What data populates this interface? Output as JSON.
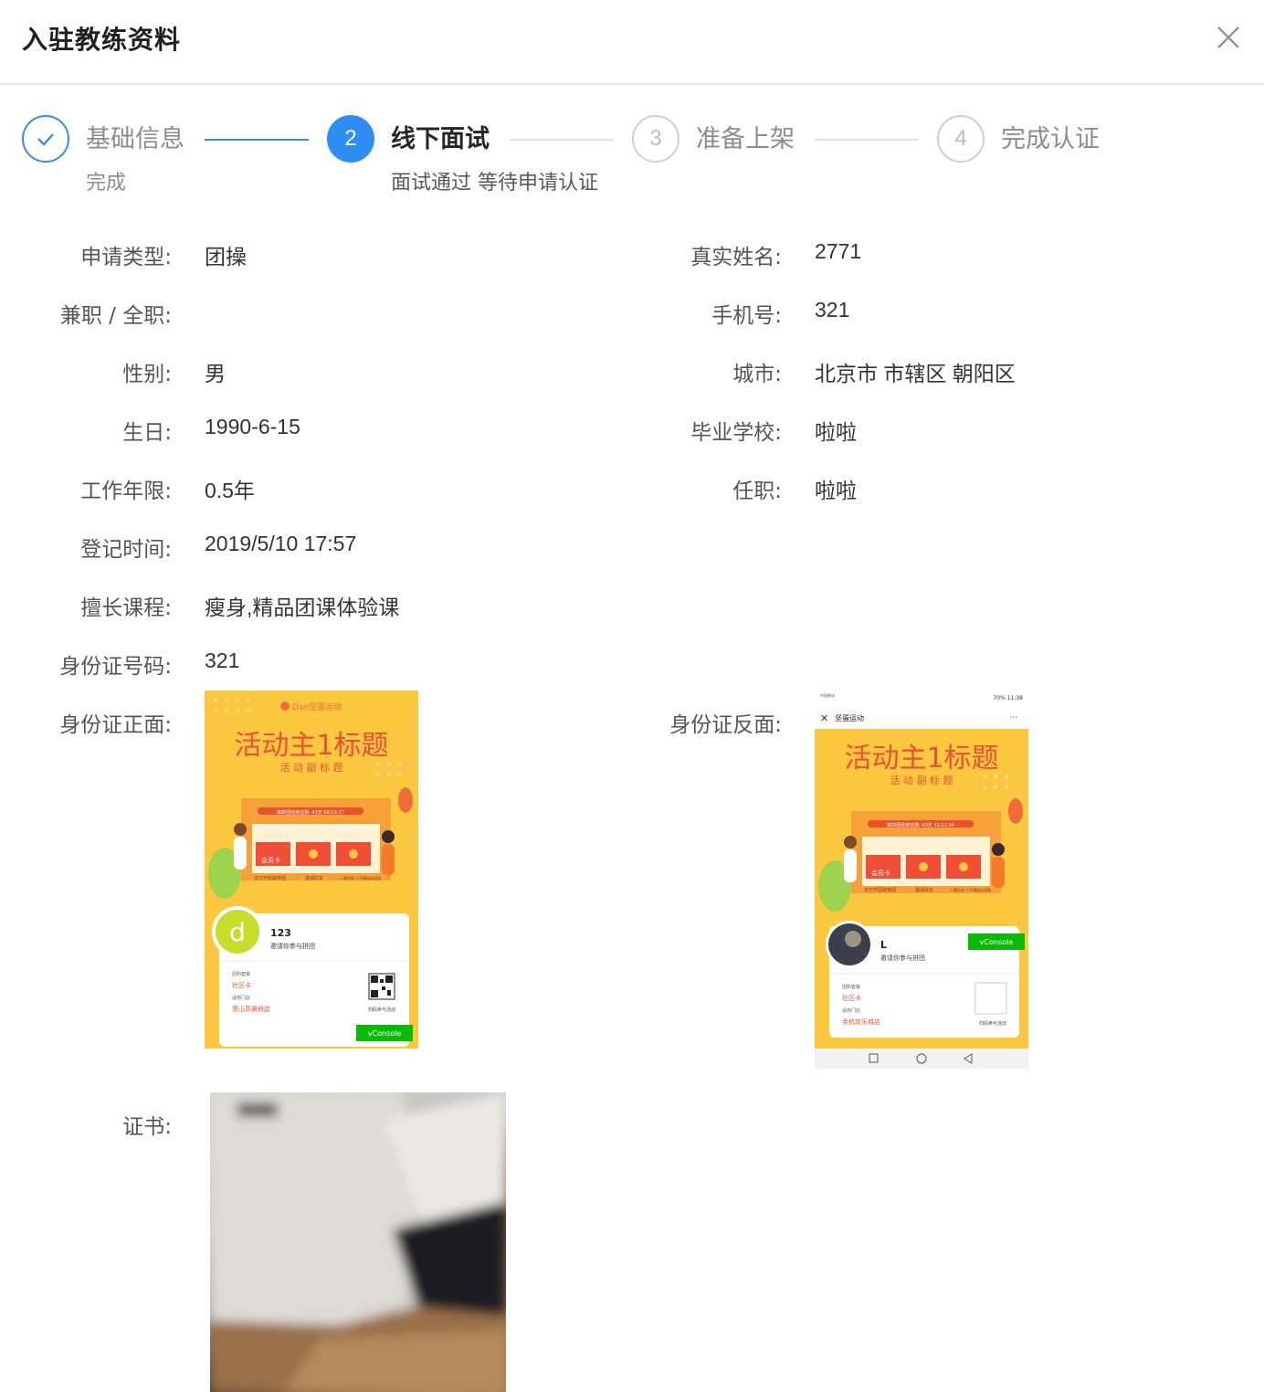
{
  "modal": {
    "title": "入驻教练资料",
    "close_icon": "close-icon"
  },
  "steps": [
    {
      "number": "",
      "title": "基础信息",
      "description": "完成",
      "status": "finish",
      "icon": "check-icon"
    },
    {
      "number": "2",
      "title": "线下面试",
      "description": "面试通过 等待申请认证",
      "status": "process"
    },
    {
      "number": "3",
      "title": "准备上架",
      "description": "",
      "status": "wait"
    },
    {
      "number": "4",
      "title": "完成认证",
      "description": "",
      "status": "wait"
    }
  ],
  "fields_left": [
    {
      "label": "申请类型:",
      "value": "团操"
    },
    {
      "label": "兼职 / 全职:",
      "value": ""
    },
    {
      "label": "性别:",
      "value": "男"
    },
    {
      "label": "生日:",
      "value": "1990-6-15"
    },
    {
      "label": "工作年限:",
      "value": "0.5年"
    },
    {
      "label": "登记时间:",
      "value": "2019/5/10 17:57"
    },
    {
      "label": "擅长课程:",
      "value": "瘦身,精品团课体验课"
    },
    {
      "label": "身份证号码:",
      "value": "321"
    }
  ],
  "fields_right": [
    {
      "label": "真实姓名:",
      "value": "2771"
    },
    {
      "label": "手机号:",
      "value": "321"
    },
    {
      "label": "城市:",
      "value": "北京市 市辖区 朝阳区"
    },
    {
      "label": "毕业学校:",
      "value": "啦啦"
    },
    {
      "label": "任职:",
      "value": "啦啦"
    }
  ],
  "images": {
    "id_front_label": "身份证正面:",
    "id_back_label": "身份证反面:",
    "certificate_label": "证书:",
    "id_front": {
      "brand": "Dan坚蛋运动",
      "headline": "活动主1标题",
      "subheadline": "活 动 副 标 题",
      "countdown": "离拼团结束还剩: 42天 08:53:17",
      "card_label": "会员卡",
      "flow_1": "支付开团或参团",
      "flow_2": "邀请好友",
      "flow_3": "人满生效 人不满自动退款",
      "user_name": "123",
      "invite_text": "邀请你参与拼团",
      "package_label": "团购套餐",
      "package_name": "社区卡",
      "store_label": "适用门店",
      "store_name": "萧山高第府店",
      "scan_text": "扫码参与活动",
      "vconsole": "vConsole"
    },
    "id_back": {
      "status_bar": "70% 11:38",
      "carrier": "中国移动",
      "app_title": "坚蛋运动",
      "more": "···",
      "headline": "活动主1标题",
      "subheadline": "活 动 副 标 题",
      "countdown": "离拼团结束还剩: 43天 12:21:24",
      "card_label": "会员卡",
      "flow_1": "支付开团或参团",
      "flow_2": "邀请好友",
      "flow_3": "人满生效 人不满自动退款",
      "user_name": "L",
      "invite_text": "邀请你参与拼团",
      "package_label": "团购套餐",
      "package_name": "社区卡",
      "store_label": "适用门店",
      "store_name": "余杭欢乐城店",
      "scan_text": "扫码参与活动",
      "vconsole": "vConsole"
    }
  },
  "colors": {
    "primary": "#2f8ef3",
    "poster_bg": "#fbc840",
    "poster_red": "#f04e37",
    "vconsole_green": "#09bb07"
  }
}
